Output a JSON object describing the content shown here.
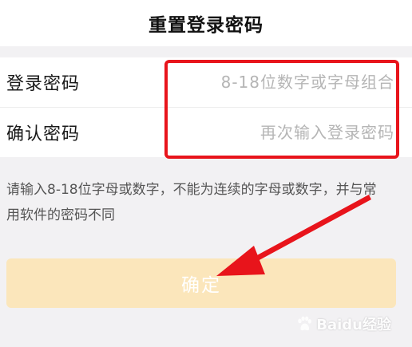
{
  "header": {
    "title": "重置登录密码"
  },
  "form": {
    "password": {
      "label": "登录密码",
      "placeholder": "8-18位数字或字母组合",
      "value": ""
    },
    "confirm": {
      "label": "确认密码",
      "placeholder": "再次输入登录密码",
      "value": ""
    }
  },
  "hint": {
    "text": "请输入8-18位字母或数字，不能为连续的字母或数字，并与常用软件的密码不同"
  },
  "confirm_button": {
    "label": "确定"
  },
  "watermark": {
    "text": "Baidu经验"
  },
  "colors": {
    "button_bg": "#fbe6bb",
    "annotation_red": "#e8141b",
    "page_bg": "#f2f1f3"
  }
}
